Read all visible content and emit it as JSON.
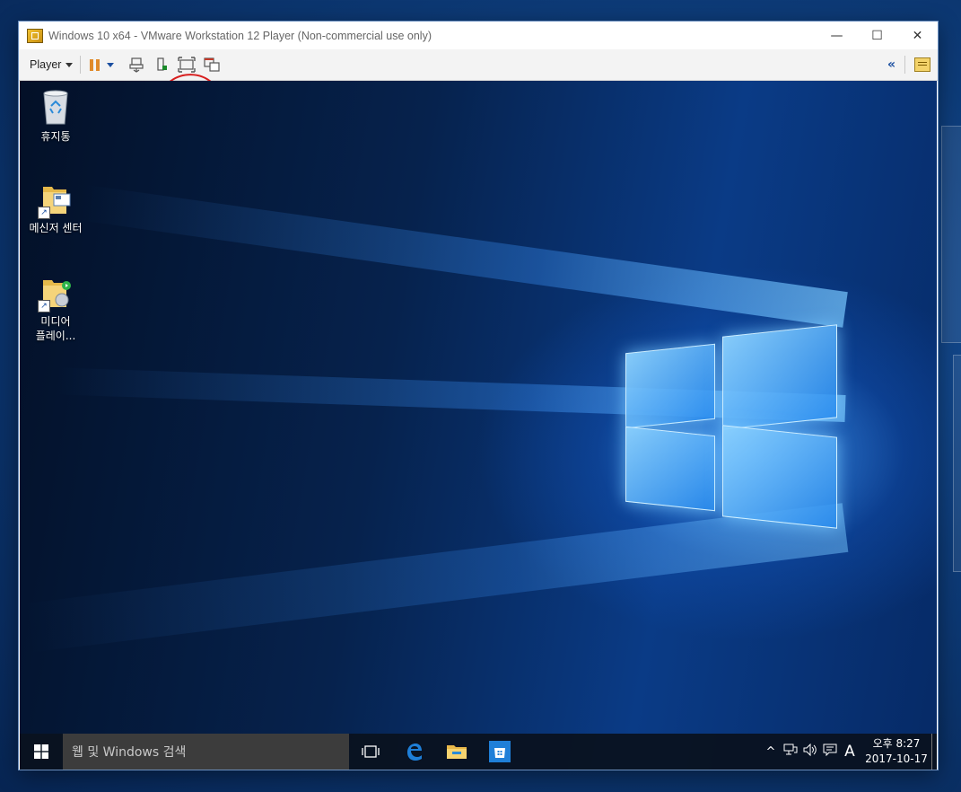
{
  "window": {
    "title": "Windows 10 x64 - VMware Workstation 12 Player (Non-commercial use only)",
    "minimize_symbol": "—",
    "maximize_symbol": "☐",
    "close_symbol": "✕"
  },
  "toolbar": {
    "player_label": "Player",
    "collapse_symbol": "«"
  },
  "desktop": {
    "icons": [
      {
        "label": "휴지통",
        "icon": "recycle-bin-icon"
      },
      {
        "label": "메신저 센터",
        "icon": "folder-shortcut-icon"
      },
      {
        "label": "미디어\n플레이...",
        "icon": "media-player-folder-icon"
      }
    ]
  },
  "taskbar": {
    "search_placeholder": "웹 및 Windows 검색",
    "apps": [
      "task-view-icon",
      "edge-icon",
      "file-explorer-icon",
      "store-icon"
    ],
    "tray": {
      "chevron": "^",
      "input_indicator": "A",
      "time": "오후 8:27",
      "date": "2017-10-17"
    }
  },
  "colors": {
    "accent": "#1a4ea0",
    "pause": "#e08a2a",
    "annotation": "#d81e1e",
    "taskbar": "#0a1220"
  }
}
